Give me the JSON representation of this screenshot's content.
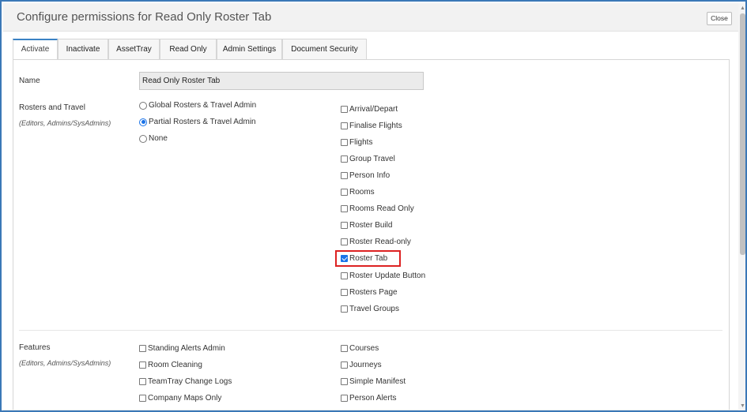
{
  "header": {
    "title": "Configure permissions for Read Only Roster Tab",
    "close_label": "Close"
  },
  "tabs": [
    {
      "label": "Activate",
      "active": true
    },
    {
      "label": "Inactivate",
      "active": false
    },
    {
      "label": "AssetTray",
      "active": false
    },
    {
      "label": "Read Only",
      "active": false
    },
    {
      "label": "Admin Settings",
      "active": false
    },
    {
      "label": "Document Security",
      "active": false
    }
  ],
  "name_section": {
    "label": "Name",
    "value": "Read Only Roster Tab"
  },
  "rosters": {
    "label": "Rosters and Travel",
    "sublabel": "(Editors, Admins/SysAdmins)",
    "radios": [
      {
        "label": "Global Rosters & Travel Admin",
        "checked": false
      },
      {
        "label": "Partial Rosters & Travel Admin",
        "checked": true
      },
      {
        "label": "None",
        "checked": false
      }
    ],
    "checkboxes": [
      {
        "label": "Arrival/Depart",
        "checked": false
      },
      {
        "label": "Finalise Flights",
        "checked": false
      },
      {
        "label": "Flights",
        "checked": false
      },
      {
        "label": "Group Travel",
        "checked": false
      },
      {
        "label": "Person Info",
        "checked": false
      },
      {
        "label": "Rooms",
        "checked": false
      },
      {
        "label": "Rooms Read Only",
        "checked": false
      },
      {
        "label": "Roster Build",
        "checked": false
      },
      {
        "label": "Roster Read-only",
        "checked": false
      },
      {
        "label": "Roster Tab",
        "checked": true
      },
      {
        "label": "Roster Update Button",
        "checked": false
      },
      {
        "label": "Rosters Page",
        "checked": false
      },
      {
        "label": "Travel Groups",
        "checked": false
      }
    ]
  },
  "features": {
    "label": "Features",
    "sublabel": "(Editors, Admins/SysAdmins)",
    "left": [
      {
        "label": "Standing Alerts Admin",
        "checked": false
      },
      {
        "label": "Room Cleaning",
        "checked": false
      },
      {
        "label": "TeamTray Change Logs",
        "checked": false
      },
      {
        "label": "Company Maps Only",
        "checked": false
      }
    ],
    "right": [
      {
        "label": "Courses",
        "checked": false
      },
      {
        "label": "Journeys",
        "checked": false
      },
      {
        "label": "Simple Manifest",
        "checked": false
      },
      {
        "label": "Person Alerts",
        "checked": false
      }
    ]
  },
  "colors": {
    "frame": "#3b78b7",
    "accent": "#1a73e8",
    "highlight": "#dd2222",
    "active_tab_border": "#3b82c4"
  }
}
